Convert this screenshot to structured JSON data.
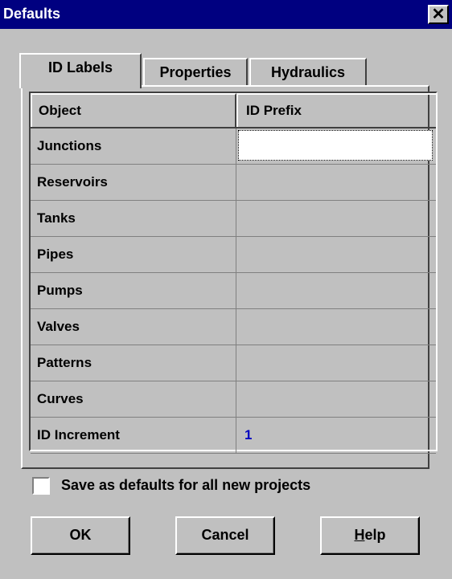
{
  "window": {
    "title": "Defaults",
    "close_glyph": "✕"
  },
  "tabs": [
    {
      "label": "ID Labels",
      "active": true
    },
    {
      "label": "Properties",
      "active": false
    },
    {
      "label": "Hydraulics",
      "active": false
    }
  ],
  "grid": {
    "headers": [
      "Object",
      "ID Prefix"
    ],
    "rows": [
      {
        "object": "Junctions",
        "value": ""
      },
      {
        "object": "Reservoirs",
        "value": ""
      },
      {
        "object": "Tanks",
        "value": ""
      },
      {
        "object": "Pipes",
        "value": ""
      },
      {
        "object": "Pumps",
        "value": ""
      },
      {
        "object": "Valves",
        "value": ""
      },
      {
        "object": "Patterns",
        "value": ""
      },
      {
        "object": "Curves",
        "value": ""
      },
      {
        "object": "ID Increment",
        "value": "1"
      }
    ]
  },
  "save_defaults": {
    "label": "Save as defaults for all new projects",
    "checked": false
  },
  "buttons": {
    "ok": "OK",
    "cancel": "Cancel",
    "help_first": "H",
    "help_rest": "elp"
  },
  "colors": {
    "titlebar": "#000080",
    "face": "#c0c0c0",
    "value": "#0000c0"
  }
}
